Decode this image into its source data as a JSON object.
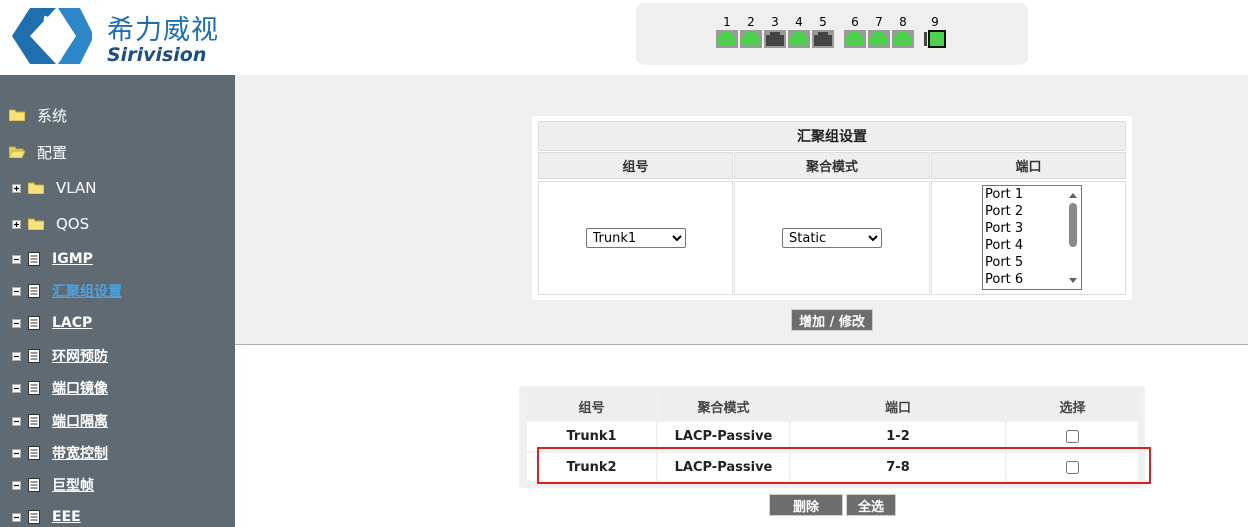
{
  "brand": {
    "name_cn": "希力威视",
    "name_en": "Sirivision",
    "accent": "#1f6fae"
  },
  "ports": [
    {
      "num": "1",
      "status": "up"
    },
    {
      "num": "2",
      "status": "up"
    },
    {
      "num": "3",
      "status": "down"
    },
    {
      "num": "4",
      "status": "up"
    },
    {
      "num": "5",
      "status": "down"
    },
    {
      "num": "6",
      "status": "up"
    },
    {
      "num": "7",
      "status": "up"
    },
    {
      "num": "8",
      "status": "up"
    },
    {
      "num": "9",
      "status": "up"
    }
  ],
  "port_colors": {
    "up": "#4ed14e",
    "down": "#444444"
  },
  "sidebar": {
    "items": [
      {
        "label": "系统",
        "icon": "folder-closed-icon",
        "level": 0
      },
      {
        "label": "配置",
        "icon": "folder-open-icon",
        "level": 0
      },
      {
        "label": "VLAN",
        "icon": "folder-closed-icon",
        "level": 1,
        "expander": "plus"
      },
      {
        "label": "QOS",
        "icon": "folder-closed-icon",
        "level": 1,
        "expander": "plus"
      },
      {
        "label": "IGMP",
        "icon": "document-icon",
        "level": 1,
        "expander": "minus"
      },
      {
        "label": "汇聚组设置",
        "icon": "document-icon",
        "level": 1,
        "expander": "minus",
        "active": true
      },
      {
        "label": "LACP",
        "icon": "document-icon",
        "level": 1,
        "expander": "minus"
      },
      {
        "label": "环网预防",
        "icon": "document-icon",
        "level": 1,
        "expander": "minus"
      },
      {
        "label": "端口镜像",
        "icon": "document-icon",
        "level": 1,
        "expander": "minus"
      },
      {
        "label": "端口隔离",
        "icon": "document-icon",
        "level": 1,
        "expander": "minus"
      },
      {
        "label": "带宽控制",
        "icon": "document-icon",
        "level": 1,
        "expander": "minus"
      },
      {
        "label": "巨型帧",
        "icon": "document-icon",
        "level": 1,
        "expander": "minus"
      },
      {
        "label": "EEE",
        "icon": "document-icon",
        "level": 1,
        "expander": "minus"
      }
    ]
  },
  "form": {
    "title": "汇聚组设置",
    "col_group": "组号",
    "col_mode": "聚合模式",
    "col_ports": "端口",
    "group_selected": "Trunk1",
    "mode_selected": "Static",
    "port_options": [
      "Port 1",
      "Port 2",
      "Port 3",
      "Port 4",
      "Port 5",
      "Port 6"
    ],
    "submit_label": "增加 / 修改"
  },
  "table": {
    "headers": [
      "组号",
      "聚合模式",
      "端口",
      "选择"
    ],
    "rows": [
      {
        "group": "Trunk1",
        "mode": "LACP-Passive",
        "ports": "1-2",
        "checked": false
      },
      {
        "group": "Trunk2",
        "mode": "LACP-Passive",
        "ports": "7-8",
        "checked": false
      }
    ],
    "delete_label": "删除",
    "select_all_label": "全选"
  }
}
